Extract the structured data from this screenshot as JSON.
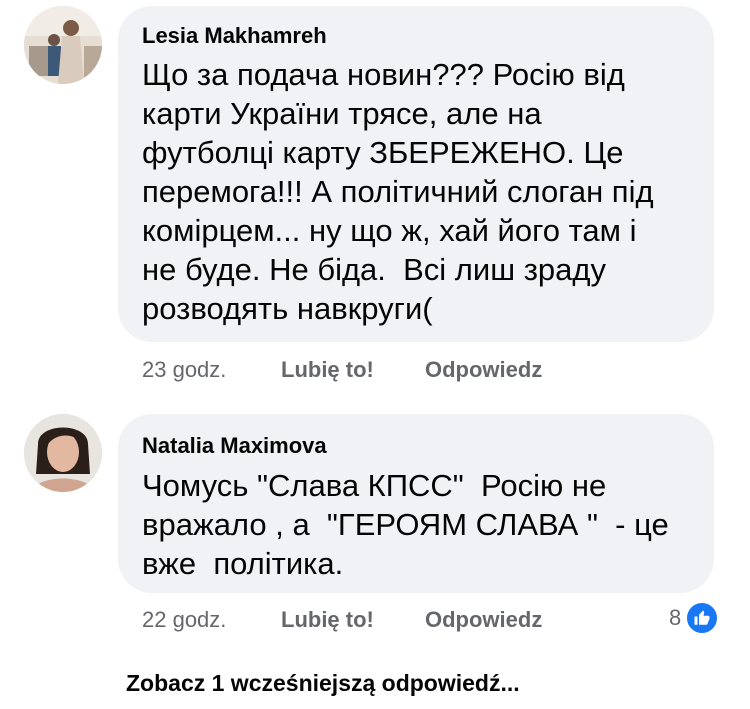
{
  "comments": [
    {
      "author": "Lesia Makhamreh",
      "lines": [
        "Що за подача новин??? Росію від",
        "карти України трясе, але на",
        "футболці карту ЗБЕРЕЖЕНО. Це",
        "перемога!!! А політичний слоган під",
        "комірцем... ну що ж, хай його там і",
        "не буде. Не біда.  Всі лиш зраду",
        "розводять навкруги("
      ],
      "time": "23 godz.",
      "like_label": "Lubię to!",
      "reply_label": "Odpowiedz"
    },
    {
      "author": "Natalia Maximova",
      "lines": [
        "Чомусь \"Слава КПСС\"  Росію не",
        "вражало , а  \"ГЕРОЯМ СЛАВА \"  - це",
        "вже  політика."
      ],
      "time": "22 godz.",
      "like_label": "Lubię to!",
      "reply_label": "Odpowiedz",
      "reaction_count": "8",
      "reaction_icon": "thumbs-up-icon",
      "reaction_color": "#1877f2"
    }
  ],
  "view_more_label": "Zobacz 1 wcześniejszą odpowiedź..."
}
